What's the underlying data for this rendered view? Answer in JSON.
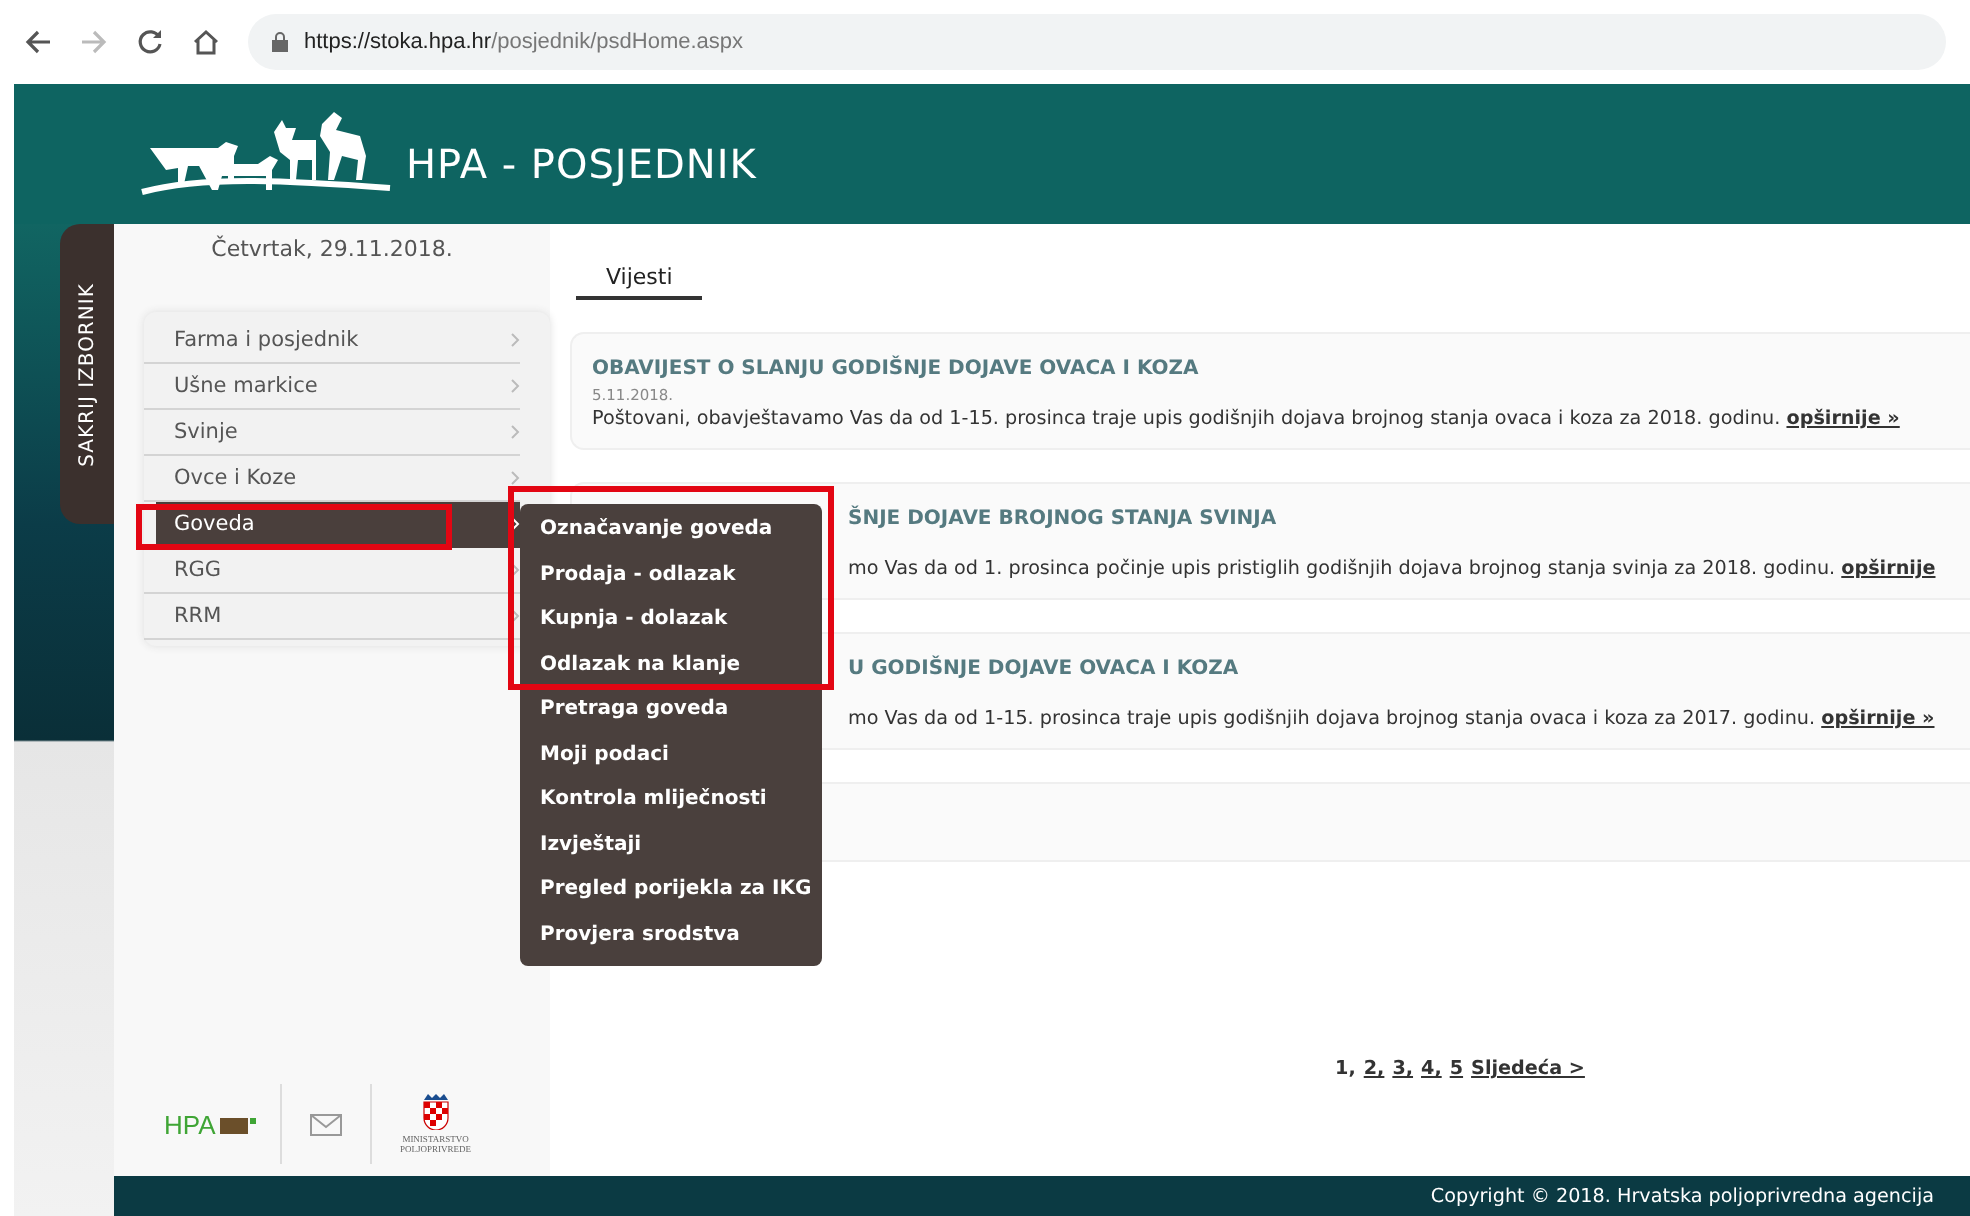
{
  "browser": {
    "url_host": "https://stoka.hpa.hr",
    "url_path": "/posjednik/psdHome.aspx"
  },
  "header": {
    "title": "HPA - POSJEDNIK"
  },
  "sidebar": {
    "toggle_label": "SAKRIJ IZBORNIK",
    "date": "Četvrtak, 29.11.2018.",
    "items": [
      {
        "label": "Farma i posjednik",
        "selected": false
      },
      {
        "label": "Ušne markice",
        "selected": false
      },
      {
        "label": "Svinje",
        "selected": false
      },
      {
        "label": "Ovce i Koze",
        "selected": false
      },
      {
        "label": "Goveda",
        "selected": true
      },
      {
        "label": "RGG",
        "selected": false
      },
      {
        "label": "RRM",
        "selected": false
      }
    ],
    "submenu": [
      {
        "label": "Označavanje goveda"
      },
      {
        "label": "Prodaja - odlazak"
      },
      {
        "label": "Kupnja - dolazak"
      },
      {
        "label": "Odlazak na klanje"
      },
      {
        "label": "Pretraga goveda"
      },
      {
        "label": "Moji podaci"
      },
      {
        "label": "Kontrola mliječnosti"
      },
      {
        "label": "Izvještaji"
      },
      {
        "label": "Pregled porijekla za IKG"
      },
      {
        "label": "Provjera srodstva"
      }
    ]
  },
  "tabs": [
    {
      "label": "Vijesti",
      "selected": true
    }
  ],
  "news": [
    {
      "kind": "full",
      "title": "OBAVIJEST O SLANJU GODIŠNJE DOJAVE OVACA I KOZA",
      "date": "5.11.2018.",
      "text": "Poštovani, obavještavamo Vas da od 1-15. prosinca traje upis godišnjih dojava brojnog stanja ovaca i koza za 2018. godinu.",
      "link": "opširnije »"
    },
    {
      "kind": "covered",
      "title": "ŠNJE DOJAVE BROJNOG STANJA SVINJA",
      "text": "mo Vas da od 1. prosinca počinje upis pristiglih godišnjih dojava brojnog stanja svinja za 2018. godinu.",
      "link": "opširnije"
    },
    {
      "kind": "covered",
      "title": "U GODIŠNJE DOJAVE OVACA I KOZA",
      "text": "mo Vas da od 1-15. prosinca traje upis godišnjih dojava brojnog stanja ovaca i koza za 2017. godinu.",
      "link": "opširnije »"
    },
    {
      "kind": "empty"
    }
  ],
  "pagination": [
    {
      "label": "1,",
      "selected": true
    },
    {
      "label": "2,",
      "selected": false
    },
    {
      "label": "3,",
      "selected": false
    },
    {
      "label": "4,",
      "selected": false
    },
    {
      "label": "5",
      "selected": false
    },
    {
      "label": "Sljedeća >",
      "selected": false
    }
  ],
  "footer": {
    "logo_text": "HPA",
    "ministry_label": "MINISTARSTVO POLJOPRIVREDE",
    "copyright": "Copyright ©  2018. Hrvatska poljoprivredna agencija"
  }
}
